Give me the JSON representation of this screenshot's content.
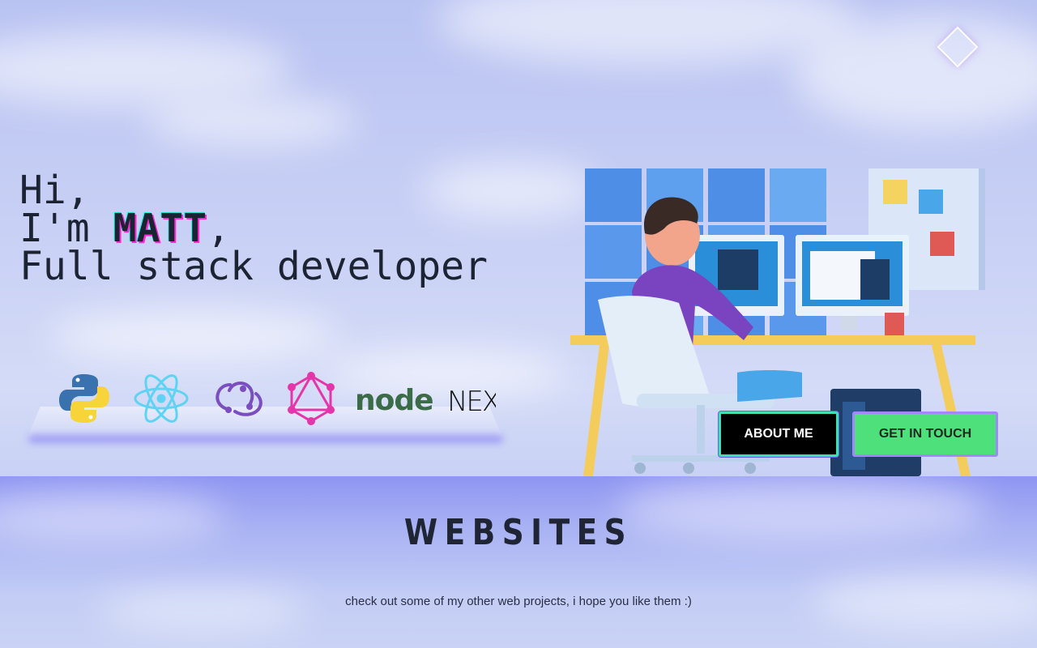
{
  "hero": {
    "line1": "Hi,",
    "line2_prefix": "I'm ",
    "name": "MATT",
    "line2_suffix": ",",
    "line3": "Full stack developer"
  },
  "tech_icons": [
    "python-icon",
    "react-icon",
    "redux-icon",
    "graphql-icon",
    "nodejs-icon",
    "nextjs-icon"
  ],
  "tech_labels": {
    "node": "node",
    "next": "NEX"
  },
  "buttons": {
    "about": "ABOUT ME",
    "contact": "GET IN TOUCH"
  },
  "websites": {
    "title": "WEBSITES",
    "subtitle": "check out some of my other web projects, i hope you like them :)"
  },
  "colors": {
    "name_glow_pink": "#ff2bd6",
    "name_glow_cyan": "#1ef5e6",
    "about_bg": "#000000",
    "contact_bg": "#4ee07a"
  }
}
